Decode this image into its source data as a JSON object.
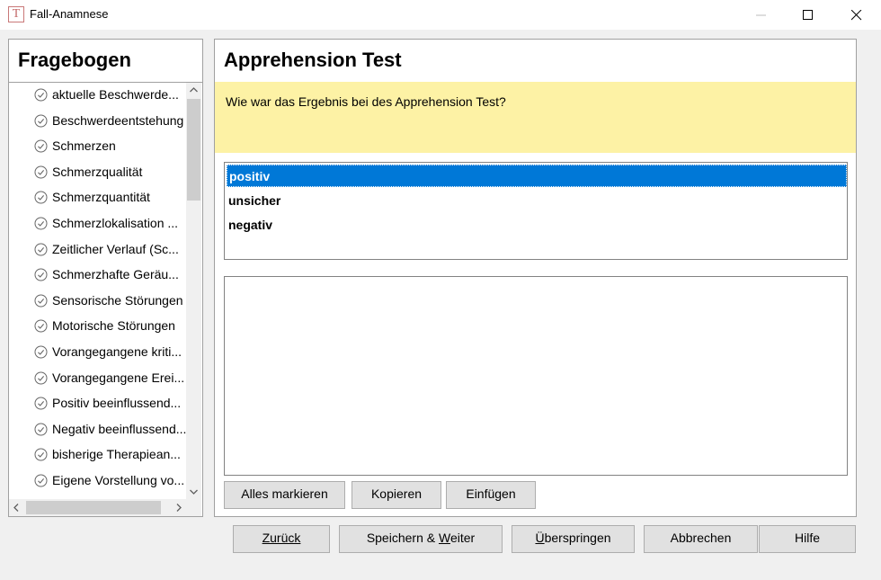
{
  "window": {
    "title": "Fall-Anamnese",
    "app_icon_letter": "T"
  },
  "sidebar": {
    "title": "Fragebogen",
    "items": [
      {
        "label": "aktuelle Beschwerde..."
      },
      {
        "label": "Beschwerdeentstehung"
      },
      {
        "label": "Schmerzen"
      },
      {
        "label": "Schmerzqualität"
      },
      {
        "label": "Schmerzquantität"
      },
      {
        "label": "Schmerzlokalisation ..."
      },
      {
        "label": "Zeitlicher Verlauf (Sc..."
      },
      {
        "label": "Schmerzhafte Geräu..."
      },
      {
        "label": "Sensorische Störungen"
      },
      {
        "label": "Motorische Störungen"
      },
      {
        "label": "Vorangegangene kriti..."
      },
      {
        "label": "Vorangegangene Erei..."
      },
      {
        "label": "Positiv beeinflussend..."
      },
      {
        "label": "Negativ beeinflussend..."
      },
      {
        "label": "bisherige Therapiean..."
      },
      {
        "label": "Eigene Vorstellung vo..."
      }
    ]
  },
  "question": {
    "title": "Apprehension Test",
    "text": "Wie war das Ergebnis bei des Apprehension Test?",
    "options": [
      {
        "label": "positiv",
        "selected": true
      },
      {
        "label": "unsicher",
        "selected": false
      },
      {
        "label": "negativ",
        "selected": false
      }
    ],
    "notes_value": ""
  },
  "edit_buttons": {
    "select_all": "Alles markieren",
    "copy": "Kopieren",
    "paste": "Einfügen"
  },
  "footer": {
    "back": "Zurück",
    "save_next_a": "Speichern & ",
    "save_next_b": "W",
    "save_next_c": "eiter",
    "skip_a": "Ü",
    "skip_b": "berspringen",
    "cancel": "Abbrechen",
    "help": "Hilfe"
  },
  "colors": {
    "selection": "#0078d7",
    "question_background": "#fdf2a5"
  }
}
